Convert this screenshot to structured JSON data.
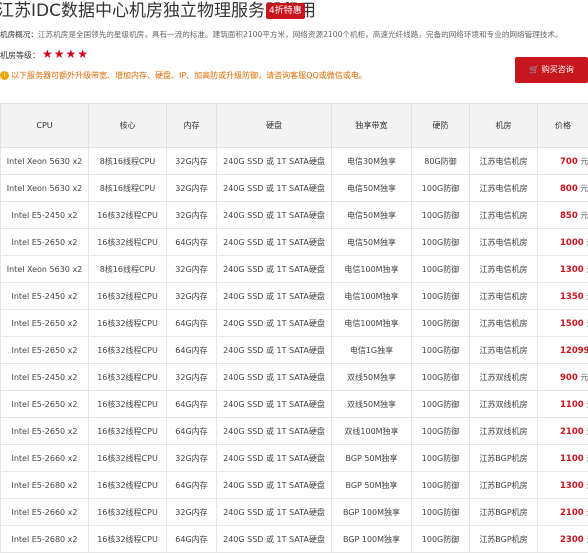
{
  "header": {
    "title": "江苏IDC数据中心机房独立物理服务器租用",
    "badge": "4折特惠",
    "intro_label": "机房概况：",
    "intro_text": "江苏机房是全国领先的星级机房，具有一流的标准。建筑面积2100平方米，网络资源2100个机柜，高速光纤线路，完备的网络环境和专业的网络管理技术。",
    "rating_label": "机房等级：",
    "rating_stars": "★★★★",
    "notice": "以下服务器可额外升级带宽、增加内存、硬盘、IP、加高防或升级防御，请咨询客服QQ或微信或电。",
    "buy_button": "购买咨询"
  },
  "colors": {
    "accent": "#c8161e",
    "notice": "#e06c00"
  },
  "table": {
    "columns": [
      "CPU",
      "核心",
      "内存",
      "硬盘",
      "独享带宽",
      "硬防",
      "机房",
      "价格"
    ],
    "rows": [
      {
        "cpu": "Intel Xeon 5630 x2",
        "cores": "8核16线程CPU",
        "ram": "32G内存",
        "disk": "240G SSD 或 1T SATA硬盘",
        "bw": "电信30M独享",
        "ddos": "80G防御",
        "room": "江苏电信机房",
        "price": "700",
        "unit": "元/月"
      },
      {
        "cpu": "Intel Xeon 5630 x2",
        "cores": "8核16线程CPU",
        "ram": "32G内存",
        "disk": "240G SSD 或 1T SATA硬盘",
        "bw": "电信50M独享",
        "ddos": "100G防御",
        "room": "江苏电信机房",
        "price": "800",
        "unit": "元/月"
      },
      {
        "cpu": "Intel E5-2450 x2",
        "cores": "16核32线程CPU",
        "ram": "32G内存",
        "disk": "240G SSD 或 1T SATA硬盘",
        "bw": "电信50M独享",
        "ddos": "100G防御",
        "room": "江苏电信机房",
        "price": "850",
        "unit": "元/月"
      },
      {
        "cpu": "Intel E5-2650 x2",
        "cores": "16核32线程CPU",
        "ram": "64G内存",
        "disk": "240G SSD 或 1T SATA硬盘",
        "bw": "电信50M独享",
        "ddos": "100G防御",
        "room": "江苏电信机房",
        "price": "1000",
        "unit": "元/月"
      },
      {
        "cpu": "Intel Xeon 5630 x2",
        "cores": "8核16线程CPU",
        "ram": "32G内存",
        "disk": "240G SSD 或 1T SATA硬盘",
        "bw": "电信100M独享",
        "ddos": "100G防御",
        "room": "江苏电信机房",
        "price": "1300",
        "unit": "元/月"
      },
      {
        "cpu": "Intel E5-2450 x2",
        "cores": "16核32线程CPU",
        "ram": "32G内存",
        "disk": "240G SSD 或 1T SATA硬盘",
        "bw": "电信100M独享",
        "ddos": "100G防御",
        "room": "江苏电信机房",
        "price": "1350",
        "unit": "元/月"
      },
      {
        "cpu": "Intel E5-2650 x2",
        "cores": "16核32线程CPU",
        "ram": "64G内存",
        "disk": "240G SSD 或 1T SATA硬盘",
        "bw": "电信100M独享",
        "ddos": "100G防御",
        "room": "江苏电信机房",
        "price": "1500",
        "unit": "元/月"
      },
      {
        "cpu": "Intel E5-2650 x2",
        "cores": "16核32线程CPU",
        "ram": "64G内存",
        "disk": "240G SSD 或 1T SATA硬盘",
        "bw": "电信1G独享",
        "ddos": "100G防御",
        "room": "江苏电信机房",
        "price": "12099",
        "unit": "元/月"
      },
      {
        "cpu": "Intel E5-2450 x2",
        "cores": "16核32线程CPU",
        "ram": "32G内存",
        "disk": "240G SSD 或 1T SATA硬盘",
        "bw": "双线50M独享",
        "ddos": "100G防御",
        "room": "江苏双线机房",
        "price": "900",
        "unit": "元/月"
      },
      {
        "cpu": "Intel E5-2650 x2",
        "cores": "16核32线程CPU",
        "ram": "64G内存",
        "disk": "240G SSD 或 1T SATA硬盘",
        "bw": "双线50M独享",
        "ddos": "100G防御",
        "room": "江苏双线机房",
        "price": "1100",
        "unit": "元/月"
      },
      {
        "cpu": "Intel E5-2650 x2",
        "cores": "16核32线程CPU",
        "ram": "64G内存",
        "disk": "240G SSD 或 1T SATA硬盘",
        "bw": "双线100M独享",
        "ddos": "100G防御",
        "room": "江苏双线机房",
        "price": "2100",
        "unit": "元/月"
      },
      {
        "cpu": "Intel E5-2660 x2",
        "cores": "16核32线程CPU",
        "ram": "32G内存",
        "disk": "240G SSD 或 1T SATA硬盘",
        "bw": "BGP 50M独享",
        "ddos": "100G防御",
        "room": "江苏BGP机房",
        "price": "1100",
        "unit": "元/月"
      },
      {
        "cpu": "Intel E5-2680 x2",
        "cores": "16核32线程CPU",
        "ram": "64G内存",
        "disk": "240G SSD 或 1T SATA硬盘",
        "bw": "BGP 50M独享",
        "ddos": "100G防御",
        "room": "江苏BGP机房",
        "price": "1300",
        "unit": "元/月"
      },
      {
        "cpu": "Intel E5-2660 x2",
        "cores": "16核32线程CPU",
        "ram": "32G内存",
        "disk": "240G SSD 或 1T SATA硬盘",
        "bw": "BGP 100M独享",
        "ddos": "100G防御",
        "room": "江苏BGP机房",
        "price": "2100",
        "unit": "元/月"
      },
      {
        "cpu": "Intel E5-2680 x2",
        "cores": "16核32线程CPU",
        "ram": "64G内存",
        "disk": "240G SSD 或 1T SATA硬盘",
        "bw": "BGP 100M独享",
        "ddos": "100G防御",
        "room": "江苏BGP机房",
        "price": "2300",
        "unit": "元/月"
      }
    ]
  }
}
